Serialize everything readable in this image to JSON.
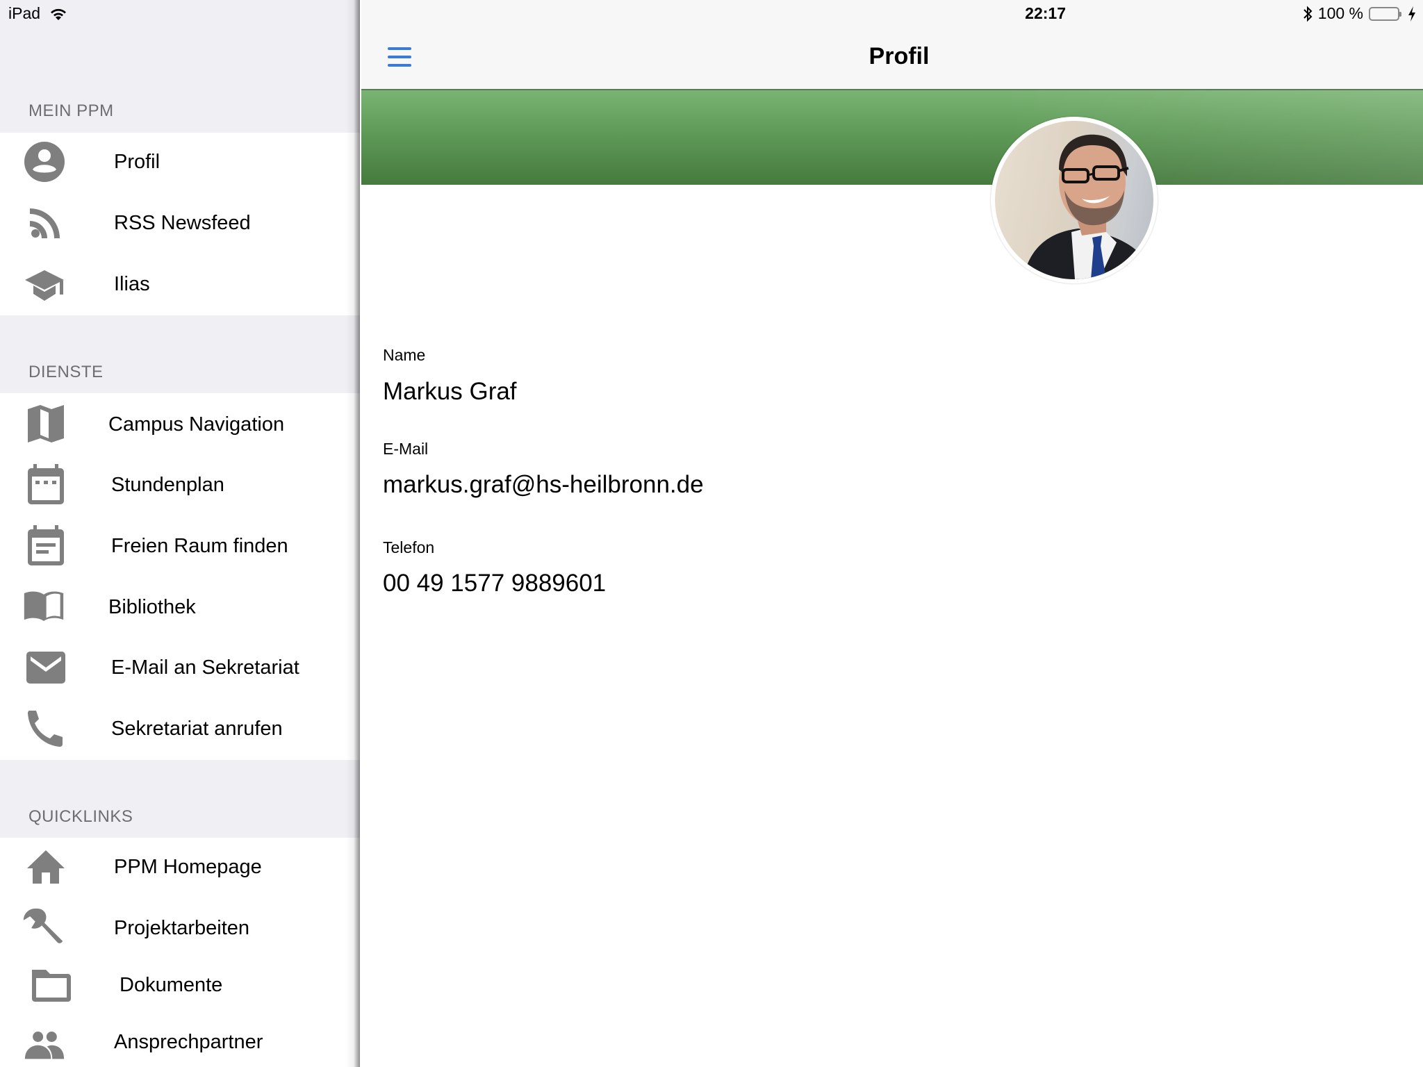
{
  "status_bar": {
    "device": "iPad",
    "time": "22:17",
    "battery_text": "100 %",
    "battery_level": 1.0,
    "icons": [
      "wifi-icon",
      "bluetooth-icon",
      "battery-icon",
      "charging-icon"
    ]
  },
  "navbar": {
    "title": "Profil",
    "menu_icon": "hamburger-menu-icon"
  },
  "sidebar": {
    "sections": [
      {
        "header": "MEIN PPM",
        "items": [
          {
            "label": "Profil",
            "icon": "account-circle-icon"
          },
          {
            "label": "RSS Newsfeed",
            "icon": "rss-feed-icon"
          },
          {
            "label": "Ilias",
            "icon": "graduation-cap-icon"
          }
        ]
      },
      {
        "header": "DIENSTE",
        "items": [
          {
            "label": "Campus Navigation",
            "icon": "map-icon"
          },
          {
            "label": "Stundenplan",
            "icon": "calendar-icon"
          },
          {
            "label": "Freien Raum finden",
            "icon": "calendar-event-icon"
          },
          {
            "label": "Bibliothek",
            "icon": "book-icon"
          },
          {
            "label": "E-Mail an Sekretariat",
            "icon": "mail-icon"
          },
          {
            "label": "Sekretariat anrufen",
            "icon": "phone-icon"
          }
        ]
      },
      {
        "header": "QUICKLINKS",
        "items": [
          {
            "label": "PPM Homepage",
            "icon": "home-icon"
          },
          {
            "label": "Projektarbeiten",
            "icon": "wrench-icon"
          },
          {
            "label": "Dokumente",
            "icon": "folder-icon"
          },
          {
            "label": "Ansprechpartner",
            "icon": "people-icon"
          }
        ]
      }
    ]
  },
  "profile": {
    "fields": [
      {
        "label": "Name",
        "value": "Markus Graf"
      },
      {
        "label": "E-Mail",
        "value": "markus.graf@hs-heilbronn.de"
      },
      {
        "label": "Telefon",
        "value": "00 49 1577 9889601"
      }
    ]
  },
  "colors": {
    "accent": "#3a7bd5",
    "banner_green": "#5f9a58",
    "icon_gray": "#7f7f7f",
    "section_header": "#6d6d72",
    "sidebar_bg": "#efeff4",
    "battery_green": "#6fd36f"
  }
}
